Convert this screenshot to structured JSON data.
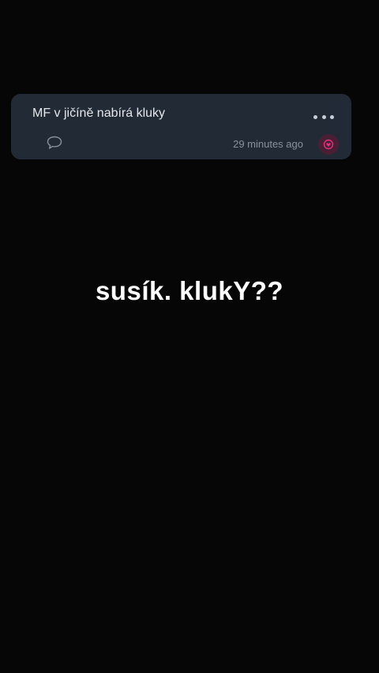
{
  "post": {
    "text": "MF v jičíně nabírá kluky",
    "timestamp": "29 minutes ago",
    "more_icon": "ellipsis-icon",
    "comment_icon": "speech-bubble-icon",
    "react_icon": "heart-icon"
  },
  "overlay": {
    "caption": "susík. klukY??"
  },
  "colors": {
    "background": "#060606",
    "card": "#222a35",
    "accent": "#e0327a"
  }
}
